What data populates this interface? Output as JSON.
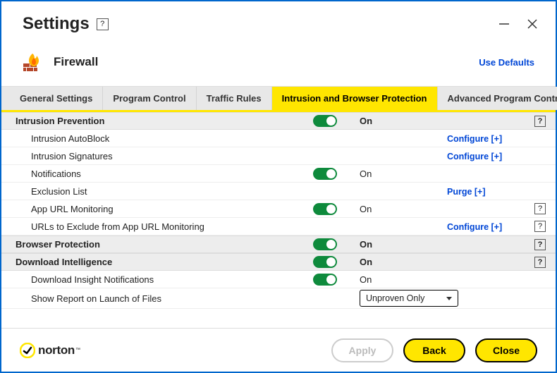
{
  "window": {
    "title": "Settings",
    "help_symbol": "?"
  },
  "header": {
    "section_title": "Firewall",
    "use_defaults": "Use Defaults"
  },
  "tabs": [
    {
      "label": "General Settings"
    },
    {
      "label": "Program Control"
    },
    {
      "label": "Traffic Rules"
    },
    {
      "label": "Intrusion and Browser Protection",
      "active": true
    },
    {
      "label": "Advanced Program Control"
    }
  ],
  "groups": {
    "intrusion_prevention": {
      "label": "Intrusion Prevention",
      "state": "On",
      "items": {
        "autoblock": {
          "label": "Intrusion AutoBlock",
          "action": "Configure [+]"
        },
        "signatures": {
          "label": "Intrusion Signatures",
          "action": "Configure [+]"
        },
        "notifications": {
          "label": "Notifications",
          "state": "On"
        },
        "exclusion": {
          "label": "Exclusion List",
          "action": "Purge [+]"
        },
        "appurl": {
          "label": "App URL Monitoring",
          "state": "On"
        },
        "urlsexclude": {
          "label": "URLs to Exclude from App URL Monitoring",
          "action": "Configure [+]"
        }
      }
    },
    "browser_protection": {
      "label": "Browser Protection",
      "state": "On"
    },
    "download_intel": {
      "label": "Download Intelligence",
      "state": "On",
      "items": {
        "insight": {
          "label": "Download Insight Notifications",
          "state": "On"
        },
        "report": {
          "label": "Show Report on Launch of Files",
          "selected": "Unproven Only"
        }
      }
    }
  },
  "footer": {
    "brand": "norton",
    "apply": "Apply",
    "back": "Back",
    "close": "Close"
  },
  "glyph": {
    "q": "?"
  }
}
